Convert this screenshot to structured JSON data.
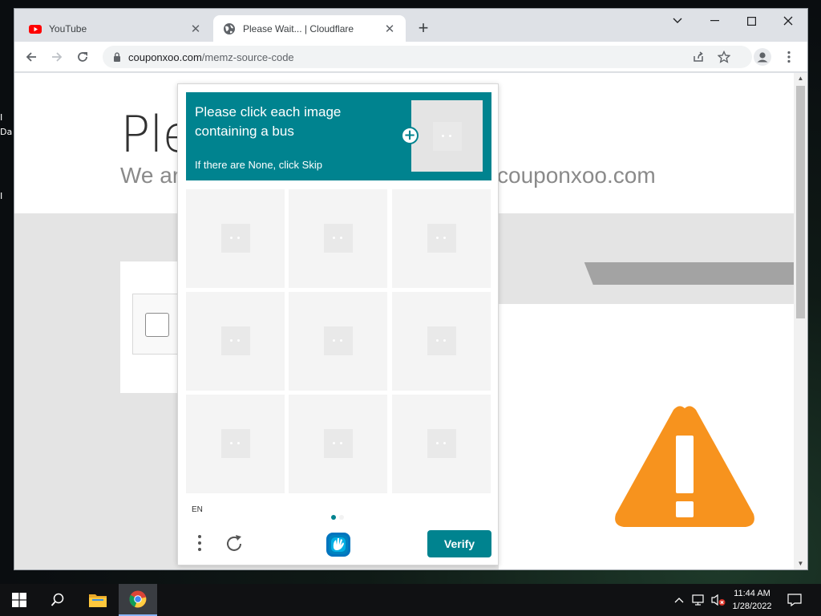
{
  "desktop": {
    "labels": [
      "I",
      "Da",
      "I"
    ]
  },
  "browser": {
    "tabs": [
      {
        "title": "YouTube",
        "active": false,
        "favicon": "youtube-icon"
      },
      {
        "title": "Please Wait... | Cloudflare",
        "active": true,
        "favicon": "globe-icon"
      }
    ],
    "url_domain": "couponxoo.com",
    "url_path": "/memz-source-code",
    "controls": [
      "back-icon",
      "forward-icon",
      "reload-icon",
      "share-icon",
      "star-icon",
      "profile-icon",
      "menu-icon"
    ]
  },
  "page": {
    "heading": "Ple",
    "subtitle": "We ar",
    "domain": "couponxoo.com"
  },
  "captcha": {
    "prompt": "Please click each image containing a bus",
    "skip_hint": "If there are None, click Skip",
    "grid_cells": 9,
    "language": "EN",
    "verify_label": "Verify",
    "accent": "#00838f",
    "pages": 2,
    "current_page": 1
  },
  "taskbar": {
    "time": "11:44 AM",
    "date": "1/28/2022",
    "apps": [
      "windows-start-icon",
      "search-icon",
      "file-explorer-icon",
      "chrome-icon"
    ]
  },
  "colors": {
    "warning": "#f7931e",
    "captcha_teal": "#00838f"
  }
}
